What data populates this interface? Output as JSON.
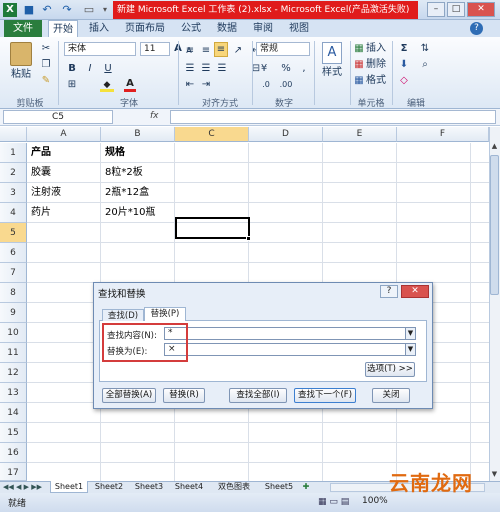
{
  "window": {
    "title": "新建 Microsoft Excel 工作表 (2).xlsx  -  Microsoft Excel(产品激活失败)"
  },
  "quick_access": {
    "save_icon": "save-icon",
    "undo_icon": "undo-icon",
    "redo_icon": "redo-icon"
  },
  "tabs": [
    {
      "label": "文件"
    },
    {
      "label": "开始"
    },
    {
      "label": "插入"
    },
    {
      "label": "页面布局"
    },
    {
      "label": "公式"
    },
    {
      "label": "数据"
    },
    {
      "label": "审阅"
    },
    {
      "label": "视图"
    }
  ],
  "ribbon": {
    "clipboard": {
      "paste": "粘贴",
      "label": "剪贴板"
    },
    "font": {
      "name": "宋体",
      "size": "11",
      "bold": "B",
      "italic": "I",
      "underline": "U",
      "grow": "A",
      "shrink": "A",
      "label": "字体"
    },
    "alignment": {
      "label": "对齐方式"
    },
    "number": {
      "format": "常规",
      "currency": "¥",
      "percent": "%",
      "comma": ",",
      "label": "数字"
    },
    "styles": {
      "style": "样式"
    },
    "cells": {
      "insert": "插入",
      "delete": "删除",
      "format": "格式",
      "label": "单元格"
    },
    "editing": {
      "sum": "Σ",
      "label": "编辑"
    }
  },
  "formula_bar": {
    "name_box": "C5",
    "fx": "fx",
    "value": ""
  },
  "columns": [
    "A",
    "B",
    "C",
    "D",
    "E",
    "F"
  ],
  "rows": [
    "1",
    "2",
    "3",
    "4",
    "5",
    "6",
    "7",
    "8",
    "9",
    "10",
    "11",
    "12",
    "13",
    "14",
    "15",
    "16",
    "17"
  ],
  "cells": [
    {
      "ref": "A1",
      "value": "产品"
    },
    {
      "ref": "B1",
      "value": "规格"
    },
    {
      "ref": "A2",
      "value": "胶囊"
    },
    {
      "ref": "B2",
      "value": "8粒*2板"
    },
    {
      "ref": "A3",
      "value": "注射液"
    },
    {
      "ref": "B3",
      "value": "2瓶*12盒"
    },
    {
      "ref": "A4",
      "value": "药片"
    },
    {
      "ref": "B4",
      "value": "20片*10瓶"
    }
  ],
  "sheets": [
    "Sheet1",
    "Sheet2",
    "Sheet3",
    "Sheet4",
    "双色图表",
    "Sheet5"
  ],
  "status": {
    "ready": "就绪",
    "zoom": "100%"
  },
  "dialog": {
    "title": "查找和替换",
    "help": "?",
    "tabs": [
      "查找(D)",
      "替换(P)"
    ],
    "find_label": "查找内容(N):",
    "find_value": "*",
    "replace_label": "替换为(E):",
    "replace_value": "×",
    "options": "选项(T) >>",
    "buttons": [
      "全部替换(A)",
      "替换(R)",
      "查找全部(I)",
      "查找下一个(F)",
      "关闭"
    ]
  },
  "watermark": "云南龙网",
  "colors": {
    "file_tab": "#2a7d3d",
    "title_highlight": "#e01b1b",
    "dialog_highlight": "#d43c3c"
  }
}
